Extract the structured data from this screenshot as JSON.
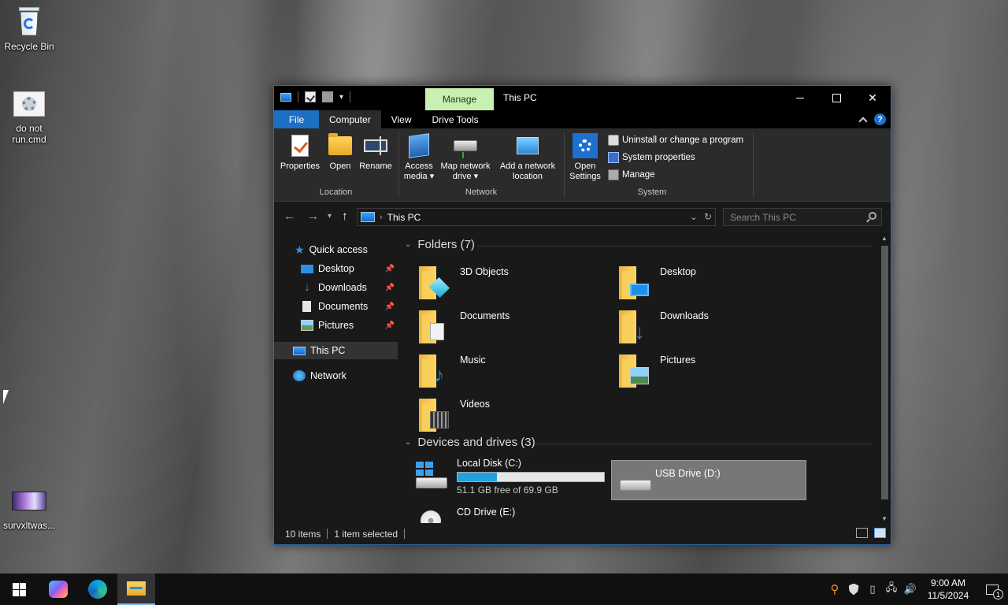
{
  "desktop": {
    "icons": [
      {
        "label": "Recycle Bin",
        "icon": "recycle-bin-icon"
      },
      {
        "label": "do not run.cmd",
        "icon": "cmd-file-icon"
      },
      {
        "label": "survxltwas...",
        "icon": "app-shortcut-icon"
      }
    ]
  },
  "window": {
    "title": "This PC",
    "contextual_tab": "Manage",
    "controls": {
      "minimize": "—",
      "maximize": "☐",
      "close": "✕"
    }
  },
  "ribbon_tabs": [
    "File",
    "Computer",
    "View",
    "Drive Tools"
  ],
  "ribbon": {
    "location": {
      "label": "Location",
      "properties": "Properties",
      "open": "Open",
      "rename": "Rename"
    },
    "network": {
      "label": "Network",
      "access_media_l1": "Access",
      "access_media_l2": "media ▾",
      "map_drive_l1": "Map network",
      "map_drive_l2": "drive ▾",
      "add_location_l1": "Add a network",
      "add_location_l2": "location"
    },
    "system": {
      "label": "System",
      "open_settings_l1": "Open",
      "open_settings_l2": "Settings",
      "uninstall": "Uninstall or change a program",
      "system_properties": "System properties",
      "manage": "Manage"
    }
  },
  "address": {
    "path": "This PC",
    "search_placeholder": "Search This PC"
  },
  "nav_pane": {
    "quick_access": "Quick access",
    "items": [
      {
        "label": "Desktop",
        "pinned": true
      },
      {
        "label": "Downloads",
        "pinned": true
      },
      {
        "label": "Documents",
        "pinned": true
      },
      {
        "label": "Pictures",
        "pinned": true
      }
    ],
    "this_pc": "This PC",
    "network": "Network"
  },
  "folders": {
    "heading": "Folders (7)",
    "items": [
      "3D Objects",
      "Desktop",
      "Documents",
      "Downloads",
      "Music",
      "Pictures",
      "Videos"
    ]
  },
  "drives": {
    "heading": "Devices and drives (3)",
    "items": [
      {
        "name": "Local Disk (C:)",
        "free_text": "51.1 GB free of 69.9 GB",
        "used_fraction": 0.269
      },
      {
        "name": "USB Drive (D:)"
      },
      {
        "name": "CD Drive (E:)"
      }
    ]
  },
  "status": {
    "items": "10 items",
    "selected": "1 item selected"
  },
  "taskbar": {
    "time": "9:00 AM",
    "date": "11/5/2024",
    "notification_count": "1"
  }
}
